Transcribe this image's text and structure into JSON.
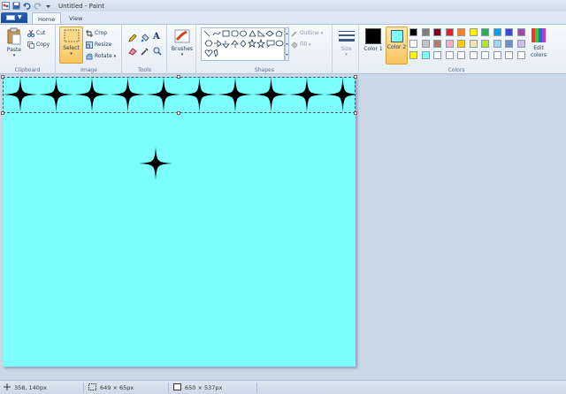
{
  "window": {
    "title": "Untitled - Paint"
  },
  "tabs": [
    {
      "label": "Home",
      "active": true
    },
    {
      "label": "View",
      "active": false
    }
  ],
  "clipboard": {
    "paste_label": "Paste",
    "cut_label": "Cut",
    "copy_label": "Copy",
    "group_label": "Clipboard"
  },
  "image": {
    "select_label": "Select",
    "crop_label": "Crop",
    "resize_label": "Resize",
    "rotate_label": "Rotate",
    "group_label": "Image"
  },
  "tools": {
    "group_label": "Tools",
    "text_tool_glyph": "A"
  },
  "brushes": {
    "label": "Brushes"
  },
  "shapes": {
    "outline_label": "Outline",
    "fill_label": "Fill",
    "group_label": "Shapes"
  },
  "size": {
    "label": "Size"
  },
  "colors": {
    "color1_label": "Color 1",
    "color1_value": "#000000",
    "color2_label": "Color 2",
    "color2_value": "#7dfefe",
    "edit_label": "Edit colors",
    "group_label": "Colors",
    "palette": [
      "#000000",
      "#7f7f7f",
      "#880015",
      "#ed1c24",
      "#ff7f27",
      "#fff200",
      "#22b14c",
      "#00a2e8",
      "#3f48cc",
      "#a349a4",
      "#ffffff",
      "#c3c3c3",
      "#b97a57",
      "#ffaec9",
      "#ffc90e",
      "#efe4b0",
      "#b5e61d",
      "#99d9ea",
      "#7092be",
      "#c8bfe7",
      "#fff200",
      "#7dfefe",
      "#ffffff",
      "#ffffff",
      "#ffffff",
      "#ffffff",
      "#ffffff",
      "#ffffff",
      "#ffffff",
      "#ffffff"
    ]
  },
  "canvas": {
    "background": "#7dfefe",
    "star_color": "#000000",
    "star_row_count": 10
  },
  "status": {
    "cursor_position": "358, 140px",
    "selection_size": "649 × 65px",
    "image_size": "650 × 537px"
  }
}
